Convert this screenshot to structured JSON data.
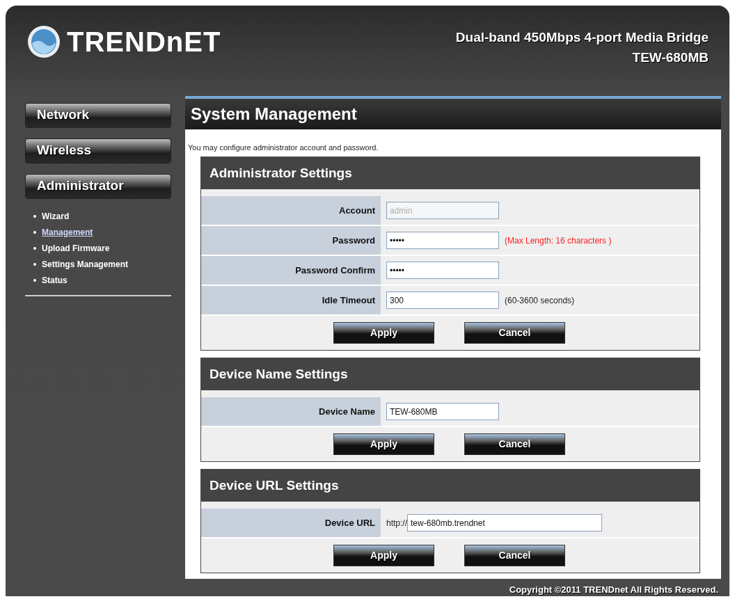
{
  "header": {
    "logo_text": "TRENDnET",
    "product": "Dual-band 450Mbps 4-port Media Bridge",
    "model": "TEW-680MB"
  },
  "sidebar": {
    "menus": [
      {
        "label": "Network"
      },
      {
        "label": "Wireless"
      },
      {
        "label": "Administrator",
        "items": [
          {
            "label": "Wizard",
            "selected": false
          },
          {
            "label": "Management",
            "selected": true
          },
          {
            "label": "Upload Firmware",
            "selected": false
          },
          {
            "label": "Settings Management",
            "selected": false
          },
          {
            "label": "Status",
            "selected": false
          }
        ]
      }
    ]
  },
  "main": {
    "title": "System Management",
    "description": "You may configure administrator account and password.",
    "sections": [
      {
        "title": "Administrator Settings",
        "fields": [
          {
            "label": "Account",
            "value": "admin",
            "disabled": true
          },
          {
            "label": "Password",
            "value": "•••••",
            "disabled": false,
            "note": "(Max Length: 16 characters )",
            "warning": true
          },
          {
            "label": "Password Confirm",
            "value": "•••••",
            "disabled": false
          },
          {
            "label": "Idle Timeout",
            "value": "300",
            "disabled": false,
            "note": "(60-3600 seconds)",
            "warning": false
          }
        ],
        "buttons": [
          "Apply",
          "Cancel"
        ]
      },
      {
        "title": "Device Name Settings",
        "fields": [
          {
            "label": "Device Name",
            "value": "TEW-680MB",
            "disabled": false
          }
        ],
        "buttons": [
          "Apply",
          "Cancel"
        ]
      },
      {
        "title": "Device URL Settings",
        "fields": [
          {
            "label": "Device URL",
            "prefix": "http://",
            "value": "tew-680mb.trendnet",
            "disabled": false
          }
        ],
        "buttons": [
          "Apply",
          "Cancel"
        ]
      }
    ]
  },
  "footer": {
    "copyright": "Copyright ©2011 TRENDnet All Rights Reserved."
  }
}
